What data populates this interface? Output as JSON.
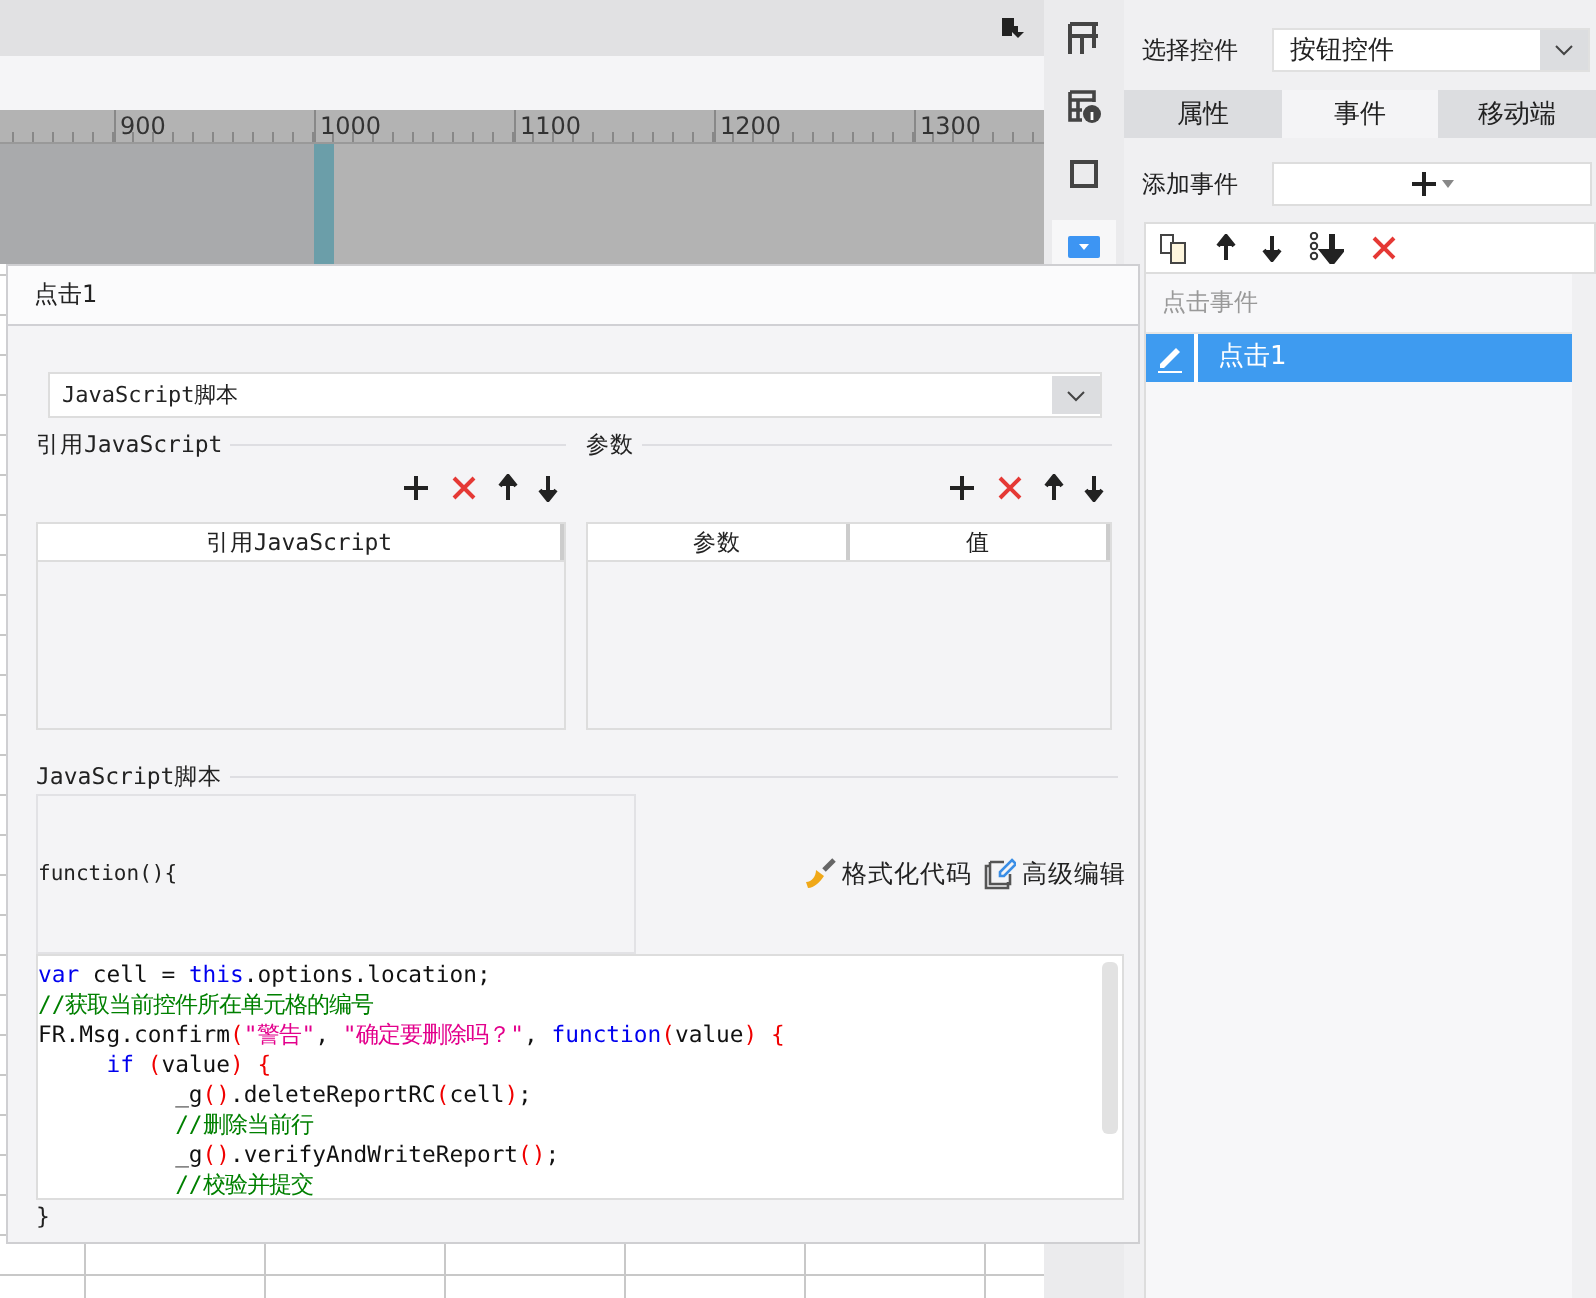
{
  "ruler": {
    "labels": [
      "900",
      "1000",
      "1100",
      "1200",
      "1300"
    ]
  },
  "side_tools": [
    {
      "kind": "grid",
      "selected": false
    },
    {
      "kind": "info",
      "selected": false
    },
    {
      "kind": "frame",
      "selected": false
    },
    {
      "kind": "dropdown",
      "selected": true
    }
  ],
  "properties_panel": {
    "control_label": "选择控件",
    "control_value": "按钮控件",
    "tabs": [
      {
        "label": "属性",
        "selected": false
      },
      {
        "label": "事件",
        "selected": true
      },
      {
        "label": "移动端",
        "selected": false
      }
    ],
    "add_event_label": "添加事件",
    "event_list": {
      "header": "点击事件",
      "items": [
        {
          "label": "点击1",
          "selected": true
        }
      ]
    }
  },
  "dialog": {
    "title": "点击1",
    "script_type": "JavaScript脚本",
    "imports": {
      "legend": "引用JavaScript",
      "columns": [
        "引用JavaScript"
      ]
    },
    "params": {
      "legend": "参数",
      "columns": [
        "参数",
        "值"
      ]
    },
    "script": {
      "legend": "JavaScript脚本",
      "signature": "function(){",
      "buttons": [
        {
          "kind": "format",
          "label": "格式化代码"
        },
        {
          "kind": "edit",
          "label": "高级编辑"
        }
      ],
      "code": [
        [
          {
            "kind": "keyword",
            "text": "var"
          },
          {
            "kind": "plain",
            "text": " cell = "
          },
          {
            "kind": "keyword",
            "text": "this"
          },
          {
            "kind": "plain",
            "text": ".options.location;"
          }
        ],
        [
          {
            "kind": "comment",
            "text": "//获取当前控件所在单元格的编号"
          }
        ],
        [
          {
            "kind": "plain",
            "text": "FR.Msg.confirm"
          },
          {
            "kind": "paren",
            "text": "("
          },
          {
            "kind": "string",
            "text": "\"警告\""
          },
          {
            "kind": "plain",
            "text": ", "
          },
          {
            "kind": "string",
            "text": "\"确定要删除吗？\""
          },
          {
            "kind": "plain",
            "text": ", "
          },
          {
            "kind": "keyword",
            "text": "function"
          },
          {
            "kind": "paren",
            "text": "("
          },
          {
            "kind": "plain",
            "text": "value"
          },
          {
            "kind": "paren",
            "text": ") {"
          }
        ],
        [
          {
            "kind": "keyword",
            "text": "     if"
          },
          {
            "kind": "paren",
            "text": " ("
          },
          {
            "kind": "plain",
            "text": "value"
          },
          {
            "kind": "paren",
            "text": ") {"
          }
        ],
        [
          {
            "kind": "plain",
            "text": "          _g"
          },
          {
            "kind": "paren",
            "text": "()"
          },
          {
            "kind": "plain",
            "text": ".deleteReportRC"
          },
          {
            "kind": "paren",
            "text": "("
          },
          {
            "kind": "plain",
            "text": "cell"
          },
          {
            "kind": "paren",
            "text": ")"
          },
          {
            "kind": "plain",
            "text": ";"
          }
        ],
        [
          {
            "kind": "comment",
            "text": "          //删除当前行"
          }
        ],
        [
          {
            "kind": "plain",
            "text": "          _g"
          },
          {
            "kind": "paren",
            "text": "()"
          },
          {
            "kind": "plain",
            "text": ".verifyAndWriteReport"
          },
          {
            "kind": "paren",
            "text": "()"
          },
          {
            "kind": "plain",
            "text": ";"
          }
        ],
        [
          {
            "kind": "comment",
            "text": "          //校验并提交"
          }
        ]
      ],
      "closing": "}"
    }
  }
}
